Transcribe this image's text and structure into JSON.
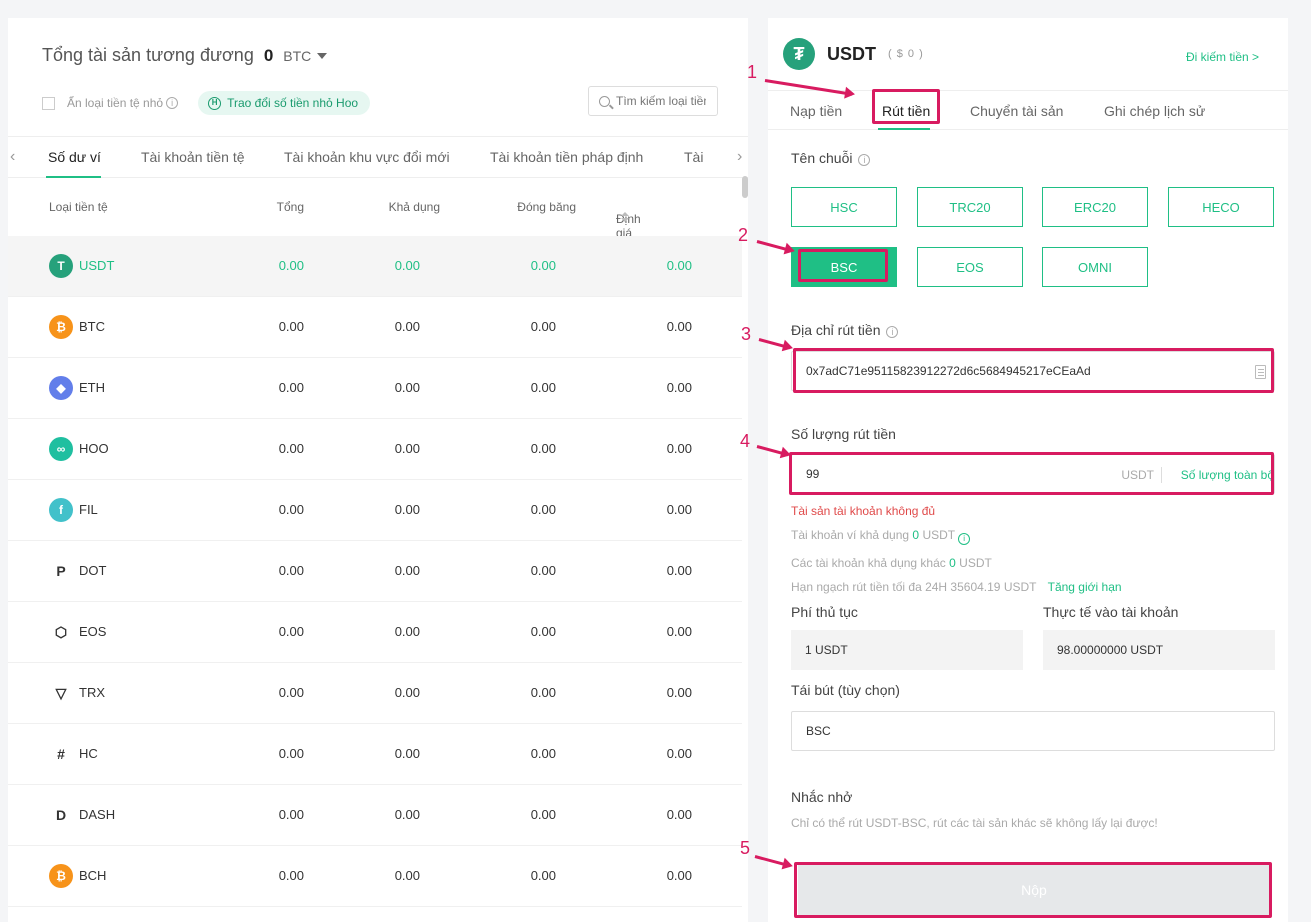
{
  "summary": {
    "label": "Tổng tài sản tương đương",
    "value": "0",
    "unit": "BTC"
  },
  "options": {
    "hide_small": "Ẩn loại tiền tệ nhỏ",
    "exchange_pill": "Trao đổi số tiền nhỏ Hoo",
    "search_placeholder": "Tìm kiếm loại tiền tệ"
  },
  "left_tabs": [
    "Số dư ví",
    "Tài khoản tiền tệ",
    "Tài khoản khu vực đổi mới",
    "Tài khoản tiền pháp định",
    "Tài khoản"
  ],
  "table": {
    "headers": [
      "Loại tiền tệ",
      "Tổng",
      "Khả dụng",
      "Đóng băng",
      "Định giá BTC"
    ],
    "rows": [
      {
        "name": "USDT",
        "icon": "tether-icon",
        "color": "#26a17b",
        "glyph": "T",
        "total": "0.00",
        "available": "0.00",
        "frozen": "0.00",
        "btc": "0.00"
      },
      {
        "name": "BTC",
        "icon": "bitcoin-icon",
        "color": "#f7931a",
        "glyph": "₿",
        "total": "0.00",
        "available": "0.00",
        "frozen": "0.00",
        "btc": "0.00"
      },
      {
        "name": "ETH",
        "icon": "ethereum-icon",
        "color": "#627eea",
        "glyph": "◆",
        "total": "0.00",
        "available": "0.00",
        "frozen": "0.00",
        "btc": "0.00"
      },
      {
        "name": "HOO",
        "icon": "hoo-icon",
        "color": "#1fbfa0",
        "glyph": "∞",
        "total": "0.00",
        "available": "0.00",
        "frozen": "0.00",
        "btc": "0.00"
      },
      {
        "name": "FIL",
        "icon": "filecoin-icon",
        "color": "#42c1ca",
        "glyph": "f",
        "total": "0.00",
        "available": "0.00",
        "frozen": "0.00",
        "btc": "0.00"
      },
      {
        "name": "DOT",
        "icon": "polkadot-icon",
        "color": "#ffffff",
        "glyph": "P",
        "total": "0.00",
        "available": "0.00",
        "frozen": "0.00",
        "btc": "0.00"
      },
      {
        "name": "EOS",
        "icon": "eos-icon",
        "color": "#ffffff",
        "glyph": "⬡",
        "total": "0.00",
        "available": "0.00",
        "frozen": "0.00",
        "btc": "0.00"
      },
      {
        "name": "TRX",
        "icon": "tron-icon",
        "color": "#ffffff",
        "glyph": "▽",
        "total": "0.00",
        "available": "0.00",
        "frozen": "0.00",
        "btc": "0.00"
      },
      {
        "name": "HC",
        "icon": "hypercash-icon",
        "color": "#ffffff",
        "glyph": "#",
        "total": "0.00",
        "available": "0.00",
        "frozen": "0.00",
        "btc": "0.00"
      },
      {
        "name": "DASH",
        "icon": "dash-icon",
        "color": "#ffffff",
        "glyph": "D",
        "total": "0.00",
        "available": "0.00",
        "frozen": "0.00",
        "btc": "0.00"
      },
      {
        "name": "BCH",
        "icon": "bitcoin-cash-icon",
        "color": "#f7931a",
        "glyph": "₿",
        "total": "0.00",
        "available": "0.00",
        "frozen": "0.00",
        "btc": "0.00"
      }
    ]
  },
  "right": {
    "coin": "USDT",
    "coin_value": "( $ 0 )",
    "earn_link": "Đi kiếm tiền >",
    "tabs": [
      "Nạp tiền",
      "Rút tiền",
      "Chuyển tài sản",
      "Ghi chép lịch sử"
    ],
    "chain_label": "Tên chuỗi",
    "chains": [
      "HSC",
      "TRC20",
      "ERC20",
      "HECO",
      "BSC",
      "EOS",
      "OMNI"
    ],
    "selected_chain": "BSC",
    "address_label": "Địa chỉ rút tiền",
    "address_value": "0x7adC71e95115823912272d6c5684945217eCEaAd",
    "amount_label": "Số lượng rút tiền",
    "amount_value": "99",
    "amount_unit": "USDT",
    "amount_all": "Số lượng toàn bộ",
    "error": "Tài sản tài khoản không đủ",
    "wallet_available": {
      "prefix": "Tài khoản ví khả dụng",
      "value": "0",
      "unit": "USDT"
    },
    "other_available": {
      "prefix": "Các tài khoản khả dụng khác",
      "value": "0",
      "unit": "USDT"
    },
    "limit": {
      "text": "Hạn ngạch rút tiền tối đa 24H 35604.19 USDT",
      "link": "Tăng giới hạn"
    },
    "fee_label": "Phí thủ tục",
    "fee_value": "1 USDT",
    "actual_label": "Thực tế vào tài khoản",
    "actual_value": "98.00000000 USDT",
    "memo_label": "Tái bút (tùy chọn)",
    "memo_value": "BSC",
    "reminder_label": "Nhắc nhở",
    "reminder_text": "Chỉ có thể rút USDT-BSC, rút các tài sản khác sẽ không lấy lại được!",
    "submit": "Nộp"
  },
  "annotations": [
    "1",
    "2",
    "3",
    "4",
    "5"
  ],
  "colors": {
    "accent": "#1fbf85",
    "annotation": "#d81b60",
    "error": "#e04a4a"
  }
}
